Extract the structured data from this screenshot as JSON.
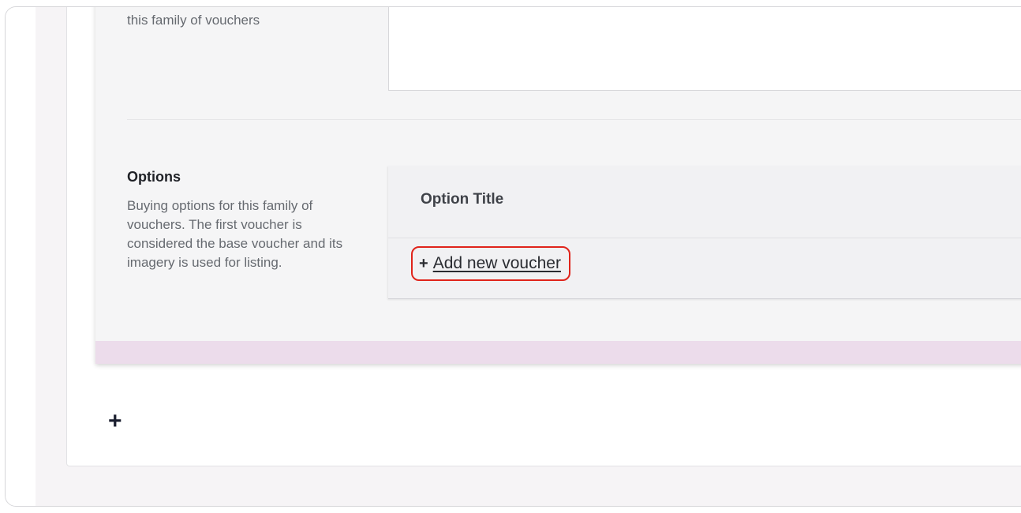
{
  "top_field": {
    "description": "this family of vouchers"
  },
  "options_section": {
    "title": "Options",
    "description": "Buying options for this family of vouchers. The first voucher is considered the base voucher and its imagery is used for listing.",
    "table": {
      "column_header": "Option Title"
    },
    "add_button": {
      "icon": "plus-icon",
      "label": "Add new voucher",
      "highlight_color": "#e0241b"
    }
  },
  "outer_add": {
    "icon": "plus-icon",
    "glyph": "+"
  },
  "colors": {
    "footer_band": "#ecdceb",
    "card_background": "#f5f5f6"
  }
}
